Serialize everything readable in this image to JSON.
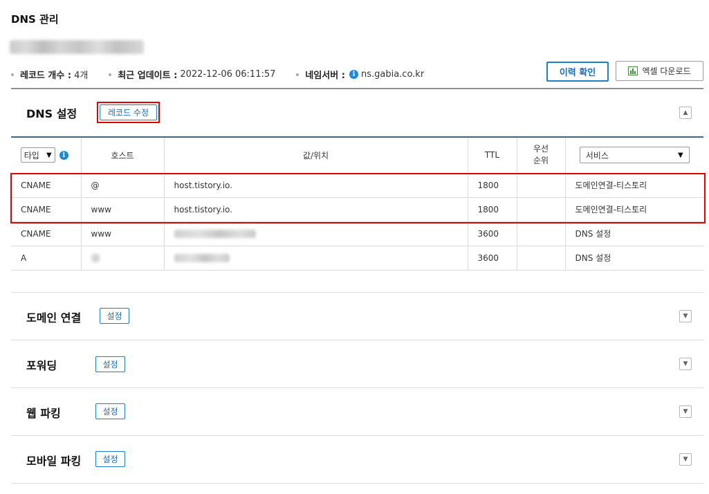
{
  "page": {
    "title": "DNS 관리"
  },
  "info": {
    "record_count_label": "레코드 개수 :",
    "record_count_value": "4개",
    "updated_label": "최근 업데이트 :",
    "updated_value": "2022-12-06 06:11:57",
    "nameserver_label": "네임서버 :",
    "nameserver_value": "ns.gabia.co.kr"
  },
  "buttons": {
    "history": "이력 확인",
    "excel": "엑셀 다운로드"
  },
  "dns_section": {
    "title": "DNS 설정",
    "edit_button": "레코드 수정",
    "columns": {
      "type": "타입",
      "host": "호스트",
      "value": "값/위치",
      "ttl": "TTL",
      "priority_line1": "우선",
      "priority_line2": "순위",
      "service": "서비스"
    },
    "rows": [
      {
        "type": "CNAME",
        "host": "@",
        "value": "host.tistory.io.",
        "ttl": "1800",
        "priority": "",
        "service": "도메인연결-티스토리"
      },
      {
        "type": "CNAME",
        "host": "www",
        "value": "host.tistory.io.",
        "ttl": "1800",
        "priority": "",
        "service": "도메인연결-티스토리"
      },
      {
        "type": "CNAME",
        "host": "www",
        "value": "",
        "ttl": "3600",
        "priority": "",
        "service": "DNS 설정"
      },
      {
        "type": "A",
        "host": "",
        "value": "",
        "ttl": "3600",
        "priority": "",
        "service": "DNS 설정"
      }
    ]
  },
  "sections": [
    {
      "title": "도메인 연결",
      "button": "설정"
    },
    {
      "title": "포워딩",
      "button": "설정"
    },
    {
      "title": "웹 파킹",
      "button": "설정"
    },
    {
      "title": "모바일 파킹",
      "button": "설정"
    }
  ],
  "colors": {
    "accent": "#1c7dc8",
    "highlight": "#e00000",
    "table_header_line": "#3d6586"
  }
}
